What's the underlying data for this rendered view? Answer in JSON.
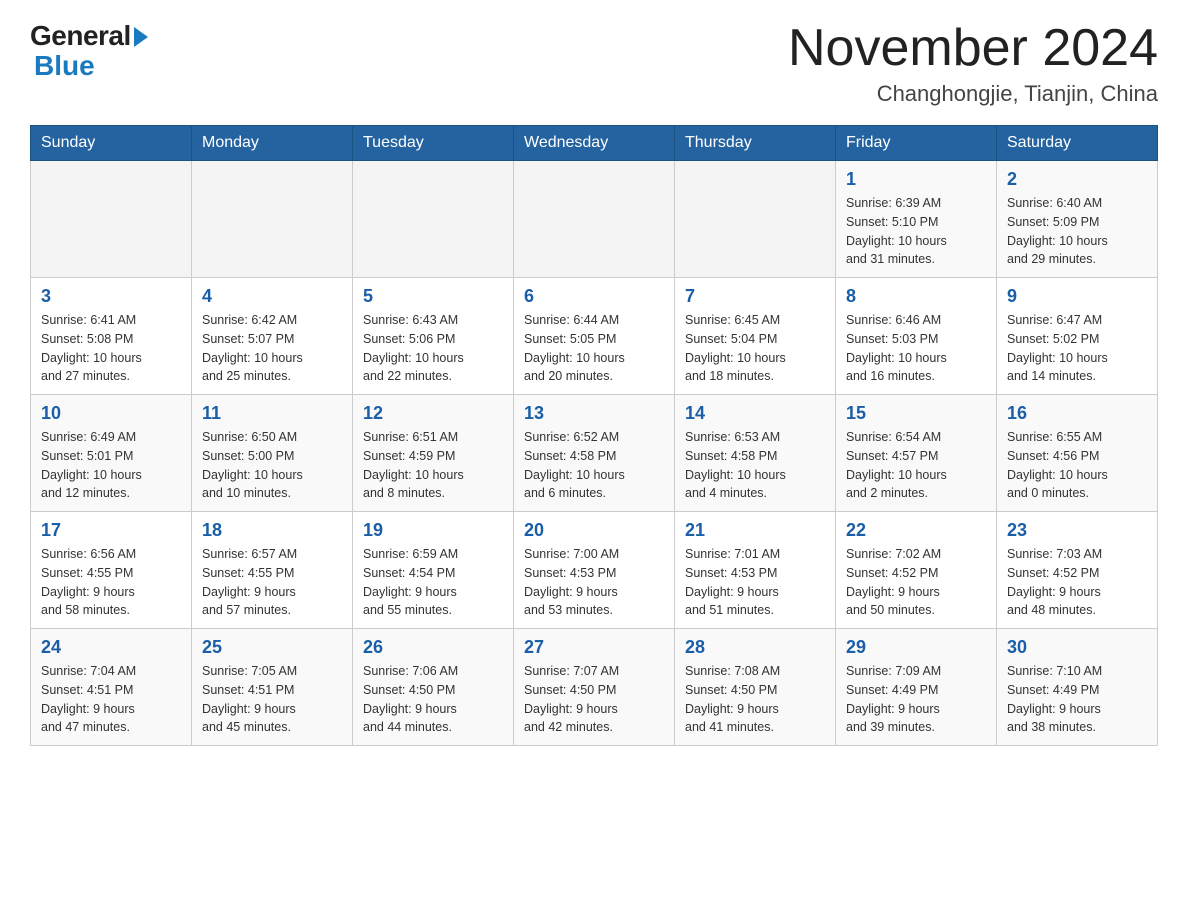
{
  "header": {
    "logo": {
      "general": "General",
      "blue": "Blue"
    },
    "title": "November 2024",
    "location": "Changhongjie, Tianjin, China"
  },
  "weekdays": [
    "Sunday",
    "Monday",
    "Tuesday",
    "Wednesday",
    "Thursday",
    "Friday",
    "Saturday"
  ],
  "weeks": [
    [
      {
        "day": "",
        "info": ""
      },
      {
        "day": "",
        "info": ""
      },
      {
        "day": "",
        "info": ""
      },
      {
        "day": "",
        "info": ""
      },
      {
        "day": "",
        "info": ""
      },
      {
        "day": "1",
        "info": "Sunrise: 6:39 AM\nSunset: 5:10 PM\nDaylight: 10 hours\nand 31 minutes."
      },
      {
        "day": "2",
        "info": "Sunrise: 6:40 AM\nSunset: 5:09 PM\nDaylight: 10 hours\nand 29 minutes."
      }
    ],
    [
      {
        "day": "3",
        "info": "Sunrise: 6:41 AM\nSunset: 5:08 PM\nDaylight: 10 hours\nand 27 minutes."
      },
      {
        "day": "4",
        "info": "Sunrise: 6:42 AM\nSunset: 5:07 PM\nDaylight: 10 hours\nand 25 minutes."
      },
      {
        "day": "5",
        "info": "Sunrise: 6:43 AM\nSunset: 5:06 PM\nDaylight: 10 hours\nand 22 minutes."
      },
      {
        "day": "6",
        "info": "Sunrise: 6:44 AM\nSunset: 5:05 PM\nDaylight: 10 hours\nand 20 minutes."
      },
      {
        "day": "7",
        "info": "Sunrise: 6:45 AM\nSunset: 5:04 PM\nDaylight: 10 hours\nand 18 minutes."
      },
      {
        "day": "8",
        "info": "Sunrise: 6:46 AM\nSunset: 5:03 PM\nDaylight: 10 hours\nand 16 minutes."
      },
      {
        "day": "9",
        "info": "Sunrise: 6:47 AM\nSunset: 5:02 PM\nDaylight: 10 hours\nand 14 minutes."
      }
    ],
    [
      {
        "day": "10",
        "info": "Sunrise: 6:49 AM\nSunset: 5:01 PM\nDaylight: 10 hours\nand 12 minutes."
      },
      {
        "day": "11",
        "info": "Sunrise: 6:50 AM\nSunset: 5:00 PM\nDaylight: 10 hours\nand 10 minutes."
      },
      {
        "day": "12",
        "info": "Sunrise: 6:51 AM\nSunset: 4:59 PM\nDaylight: 10 hours\nand 8 minutes."
      },
      {
        "day": "13",
        "info": "Sunrise: 6:52 AM\nSunset: 4:58 PM\nDaylight: 10 hours\nand 6 minutes."
      },
      {
        "day": "14",
        "info": "Sunrise: 6:53 AM\nSunset: 4:58 PM\nDaylight: 10 hours\nand 4 minutes."
      },
      {
        "day": "15",
        "info": "Sunrise: 6:54 AM\nSunset: 4:57 PM\nDaylight: 10 hours\nand 2 minutes."
      },
      {
        "day": "16",
        "info": "Sunrise: 6:55 AM\nSunset: 4:56 PM\nDaylight: 10 hours\nand 0 minutes."
      }
    ],
    [
      {
        "day": "17",
        "info": "Sunrise: 6:56 AM\nSunset: 4:55 PM\nDaylight: 9 hours\nand 58 minutes."
      },
      {
        "day": "18",
        "info": "Sunrise: 6:57 AM\nSunset: 4:55 PM\nDaylight: 9 hours\nand 57 minutes."
      },
      {
        "day": "19",
        "info": "Sunrise: 6:59 AM\nSunset: 4:54 PM\nDaylight: 9 hours\nand 55 minutes."
      },
      {
        "day": "20",
        "info": "Sunrise: 7:00 AM\nSunset: 4:53 PM\nDaylight: 9 hours\nand 53 minutes."
      },
      {
        "day": "21",
        "info": "Sunrise: 7:01 AM\nSunset: 4:53 PM\nDaylight: 9 hours\nand 51 minutes."
      },
      {
        "day": "22",
        "info": "Sunrise: 7:02 AM\nSunset: 4:52 PM\nDaylight: 9 hours\nand 50 minutes."
      },
      {
        "day": "23",
        "info": "Sunrise: 7:03 AM\nSunset: 4:52 PM\nDaylight: 9 hours\nand 48 minutes."
      }
    ],
    [
      {
        "day": "24",
        "info": "Sunrise: 7:04 AM\nSunset: 4:51 PM\nDaylight: 9 hours\nand 47 minutes."
      },
      {
        "day": "25",
        "info": "Sunrise: 7:05 AM\nSunset: 4:51 PM\nDaylight: 9 hours\nand 45 minutes."
      },
      {
        "day": "26",
        "info": "Sunrise: 7:06 AM\nSunset: 4:50 PM\nDaylight: 9 hours\nand 44 minutes."
      },
      {
        "day": "27",
        "info": "Sunrise: 7:07 AM\nSunset: 4:50 PM\nDaylight: 9 hours\nand 42 minutes."
      },
      {
        "day": "28",
        "info": "Sunrise: 7:08 AM\nSunset: 4:50 PM\nDaylight: 9 hours\nand 41 minutes."
      },
      {
        "day": "29",
        "info": "Sunrise: 7:09 AM\nSunset: 4:49 PM\nDaylight: 9 hours\nand 39 minutes."
      },
      {
        "day": "30",
        "info": "Sunrise: 7:10 AM\nSunset: 4:49 PM\nDaylight: 9 hours\nand 38 minutes."
      }
    ]
  ]
}
